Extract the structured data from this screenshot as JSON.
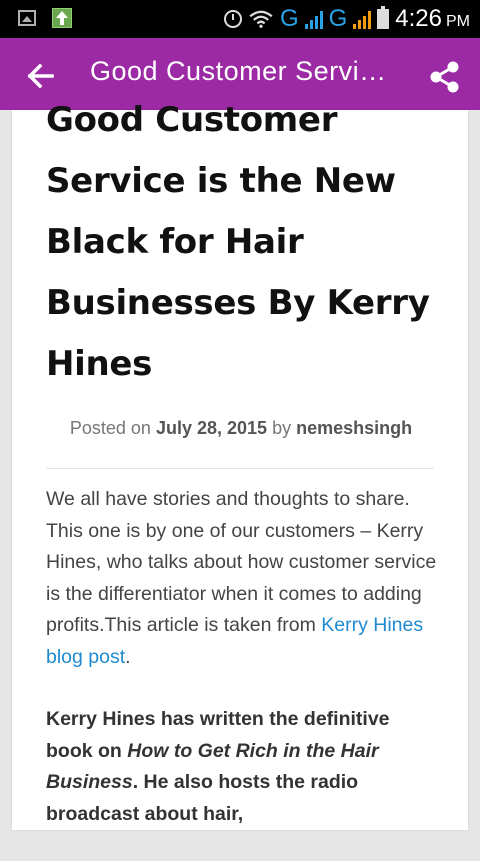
{
  "status_bar": {
    "time": "4:26",
    "ampm": "PM",
    "network_1": "G",
    "network_2": "G",
    "icons": [
      "image-icon",
      "upload-icon",
      "alarm-icon",
      "wifi-icon",
      "signal-icon",
      "battery-icon"
    ]
  },
  "toolbar": {
    "title": "Good Customer Servi…",
    "back_icon": "arrow-left-icon",
    "share_icon": "share-icon",
    "color": "#9c2aa5"
  },
  "post": {
    "title": "Good Customer Service is the New Black for Hair Businesses By Kerry Hines",
    "meta": {
      "posted_on": "Posted on",
      "date": "July 28, 2015",
      "by": "by",
      "author": "nemeshsingh"
    },
    "paragraph_1": {
      "text": "We all have stories and thoughts to share. This one is by one of our customers – Kerry Hines, who talks about how customer service is the differentiator when it comes to adding profits.This article is taken from ",
      "link_text": "Kerry Hines blog post",
      "after_link": "."
    },
    "paragraph_2": {
      "bold_start": "Kerry Hines has written the definitive book on ",
      "book_title": "How to Get Rich in the Hair Business",
      "bold_end": ".  He also hosts the radio broadcast about hair,"
    }
  },
  "colors": {
    "link": "#1e8bd0",
    "accent": "#9c2aa5"
  }
}
